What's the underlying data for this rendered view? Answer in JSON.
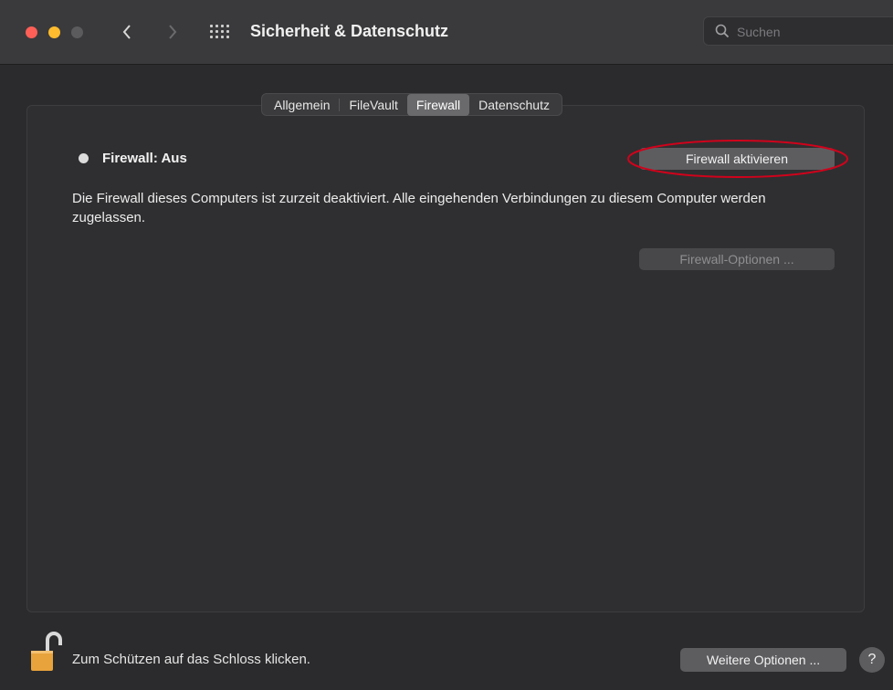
{
  "window": {
    "title": "Sicherheit & Datenschutz",
    "search_placeholder": "Suchen"
  },
  "tabs": [
    {
      "label": "Allgemein",
      "active": false
    },
    {
      "label": "FileVault",
      "active": false
    },
    {
      "label": "Firewall",
      "active": true
    },
    {
      "label": "Datenschutz",
      "active": false
    }
  ],
  "firewall": {
    "status_label": "Firewall: Aus",
    "activate_button": "Firewall aktivieren",
    "description": "Die Firewall dieses Computers ist zurzeit deaktiviert. Alle eingehenden Verbindungen zu diesem Computer werden zugelassen.",
    "options_button": "Firewall-Optionen ...",
    "highlight_color": "#d0021b"
  },
  "footer": {
    "lock_text": "Zum Schützen auf das Schloss klicken.",
    "more_options_button": "Weitere Optionen ...",
    "help_label": "?"
  },
  "icons": {
    "lock": "unlocked-padlock-icon",
    "search": "magnifier-icon",
    "grid": "grid-icon"
  }
}
